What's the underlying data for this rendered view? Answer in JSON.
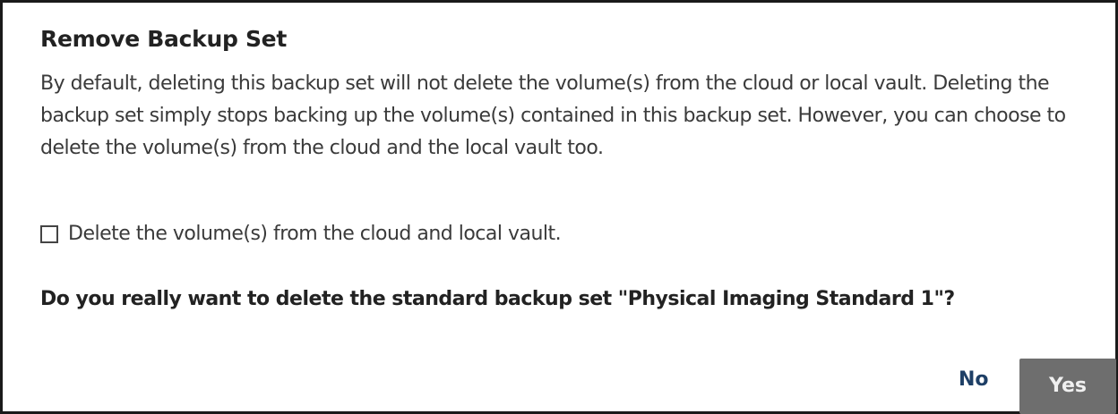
{
  "dialog": {
    "title": "Remove Backup Set",
    "description": "By default, deleting this backup set will not delete the volume(s) from the cloud or local vault. Deleting the backup set simply stops backing up the volume(s) contained in this backup set. However, you can choose to delete the volume(s) from the cloud and the local vault too.",
    "option": {
      "label": "Delete the volume(s) from the cloud and local vault.",
      "checked": false
    },
    "question": "Do you really want to delete the standard backup set \"Physical Imaging Standard 1\"?",
    "buttons": {
      "no_label": "No",
      "yes_label": "Yes"
    }
  },
  "colors": {
    "border": "#1a1a1a",
    "text": "#3a3a3a",
    "no_link": "#1e3f66",
    "yes_background": "#6e6e6e"
  },
  "icons": {
    "checkbox": "checkbox-unchecked-icon"
  }
}
